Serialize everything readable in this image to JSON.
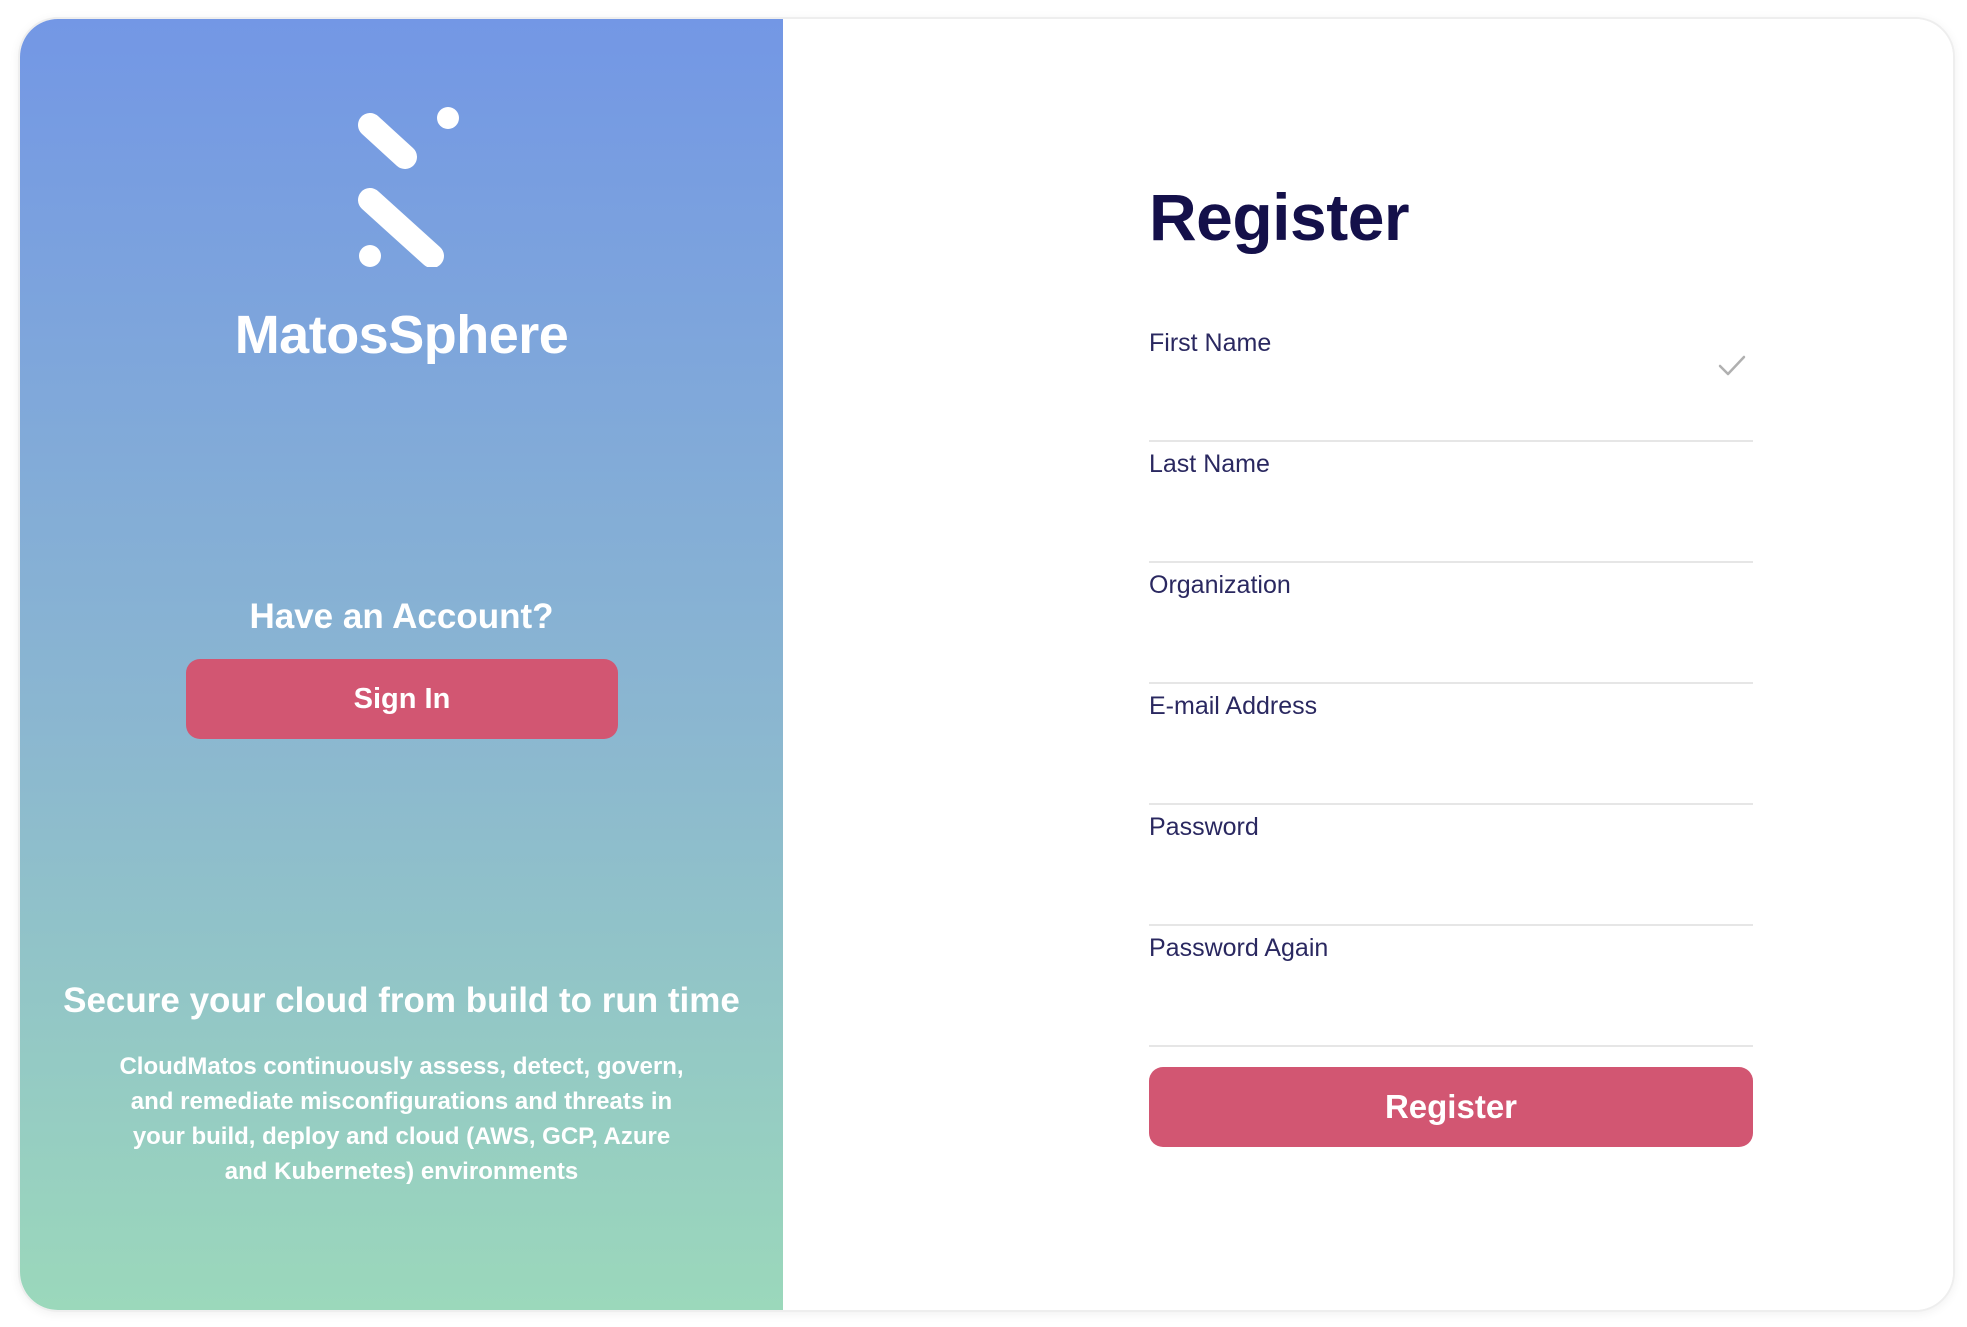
{
  "brand": {
    "name": "MatosSphere",
    "logo_icon": "matossphere-logo-icon"
  },
  "left_panel": {
    "have_account": "Have an Account?",
    "sign_in_label": "Sign In",
    "tagline": "Secure your cloud from build to run time",
    "description": "CloudMatos continuously assess, detect, govern, and remediate misconfigurations and threats in your build, deploy and cloud (AWS, GCP, Azure and Kubernetes) environments",
    "gradient_top": "#7397e5",
    "gradient_bottom": "#9bd8bb"
  },
  "form": {
    "title": "Register",
    "fields": [
      {
        "label": "First Name",
        "value": "",
        "valid": true
      },
      {
        "label": "Last Name",
        "value": ""
      },
      {
        "label": "Organization",
        "value": ""
      },
      {
        "label": "E-mail Address",
        "value": ""
      },
      {
        "label": "Password",
        "value": ""
      },
      {
        "label": "Password Again",
        "value": ""
      }
    ],
    "submit_label": "Register",
    "accent_color": "#d25672",
    "title_color": "#14104a"
  }
}
